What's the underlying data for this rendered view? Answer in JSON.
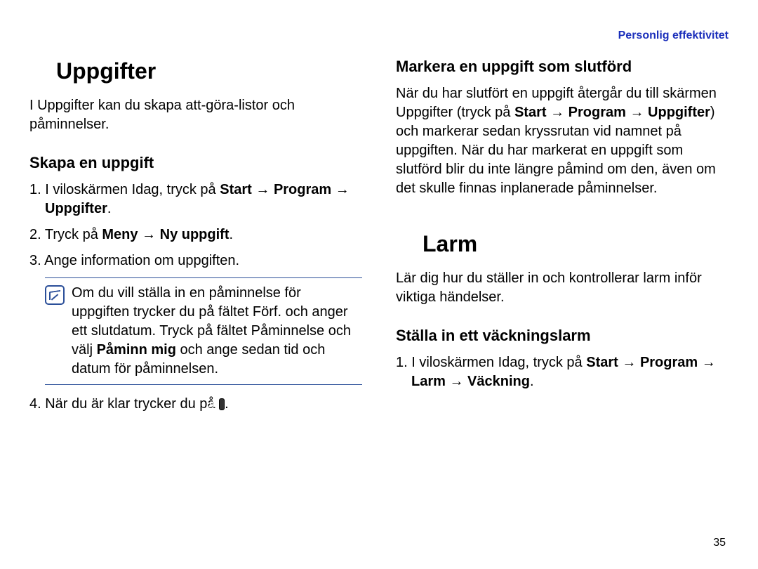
{
  "header": {
    "link": "Personlig effektivitet"
  },
  "left": {
    "title": "Uppgifter",
    "intro": "I Uppgifter kan du skapa att-göra-listor och påminnelser.",
    "sub1": "Skapa en uppgift",
    "step1_pre": "1. I viloskärmen Idag, tryck på ",
    "step1_b1": "Start",
    "step1_arrow1": " → ",
    "step1_b2": "Program",
    "step1_arrow2": " → ",
    "step1_b3": "Uppgifter",
    "step1_end": ".",
    "step2_pre": "2. Tryck på ",
    "step2_b1": "Meny",
    "step2_arrow": " → ",
    "step2_b2": "Ny uppgift",
    "step2_end": ".",
    "step3": "3. Ange information om uppgiften.",
    "note_pre": "Om du vill ställa in en påminnelse för uppgiften trycker du på fältet Förf. och anger ett slutdatum. Tryck på fältet Påminnelse och välj ",
    "note_b": "Påminn mig",
    "note_post": " och ange sedan tid och datum för påminnelsen.",
    "step4_pre": "4. När du är klar trycker du på ",
    "step4_ok": "ok",
    "step4_end": "."
  },
  "right": {
    "sub1": "Markera en uppgift som slutförd",
    "para_pre": "När du har slutfört en uppgift återgår du till skärmen Uppgifter (tryck på ",
    "para_b1": "Start",
    "para_a1": " → ",
    "para_b2": "Program",
    "para_a2": " → ",
    "para_b3": "Uppgifter",
    "para_mid": ") och markerar sedan kryssrutan vid namnet på uppgiften. När du har markerat en uppgift som slutförd blir du inte längre påmind om den, även om det skulle finnas inplanerade påminnelser.",
    "title2": "Larm",
    "intro2": "Lär dig hur du ställer in och kontrollerar larm inför viktiga händelser.",
    "sub2": "Ställa in ett väckningslarm",
    "s2step1_pre": "1. I viloskärmen Idag, tryck på ",
    "s2_b1": "Start",
    "s2_a1": " → ",
    "s2_b2": "Program",
    "s2_a2": " → ",
    "s2_b3": "Larm",
    "s2_a3": " → ",
    "s2_b4": "Väckning",
    "s2_end": "."
  },
  "page": "35"
}
